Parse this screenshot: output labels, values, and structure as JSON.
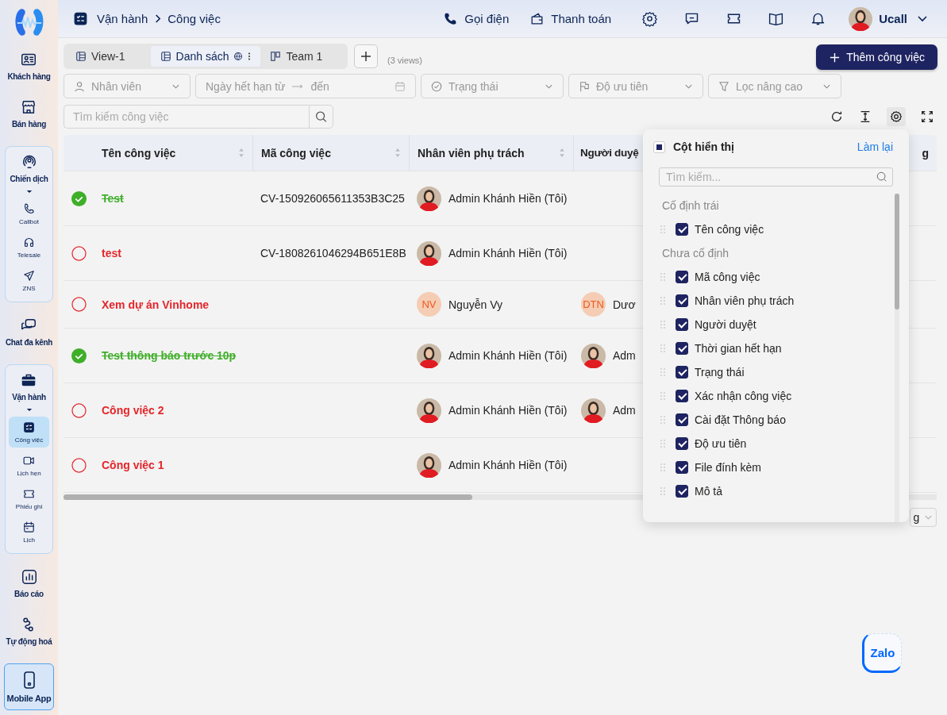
{
  "sidebar": {
    "items": [
      {
        "kind": "link",
        "label": "Khách hàng"
      },
      {
        "kind": "link",
        "label": "Bán hàng"
      },
      {
        "kind": "group",
        "label": "Chiến dịch",
        "expanded": true,
        "children": [
          {
            "label": "Callbot",
            "selected": false
          },
          {
            "label": "Telesale",
            "selected": false
          },
          {
            "label": "ZNS",
            "selected": false
          }
        ]
      },
      {
        "kind": "link",
        "label": "Chat đa kênh"
      },
      {
        "kind": "group",
        "label": "Vận hành",
        "expanded": true,
        "children": [
          {
            "label": "Công việc",
            "selected": true
          },
          {
            "label": "Lịch hẹn",
            "selected": false
          },
          {
            "label": "Phiếu ghi",
            "selected": false
          },
          {
            "label": "Lịch",
            "selected": false
          }
        ]
      },
      {
        "kind": "link",
        "label": "Báo cáo"
      },
      {
        "kind": "link",
        "label": "Tự động hoá"
      },
      {
        "kind": "app",
        "label": "Mobile App"
      }
    ]
  },
  "topbar": {
    "breadcrumb": [
      "Vận hành",
      "Công việc"
    ],
    "actions": [
      "Gọi điện",
      "Thanh toán"
    ],
    "user": "Ucall"
  },
  "views": {
    "tabs": [
      {
        "label": "View-1",
        "selected": false
      },
      {
        "label": "Danh sách",
        "selected": true
      },
      {
        "label": "Team 1",
        "selected": false
      }
    ],
    "count": "(3 views)"
  },
  "add_button": "Thêm công việc",
  "filters": {
    "staff": "Nhân viên",
    "date_from": "Ngày hết hạn từ",
    "date_to": "đến",
    "status": "Trạng thái",
    "priority": "Độ ưu tiên",
    "advanced": "Lọc nâng cao"
  },
  "search": {
    "placeholder": "Tìm kiếm công việc"
  },
  "table": {
    "columns": [
      "Tên công việc",
      "Mã công việc",
      "Nhân viên phụ trách",
      "Người duyệ",
      "g"
    ],
    "rows": [
      {
        "done": true,
        "name": "Test",
        "code": "CV-150926065611353B3C25",
        "assignee": {
          "kind": "photo",
          "name": "Admin Khánh Hiền (Tôi)"
        }
      },
      {
        "done": false,
        "name": "test",
        "code": "CV-1808261046294B651E8B",
        "assignee": {
          "kind": "photo",
          "name": "Admin Khánh Hiền (Tôi)"
        }
      },
      {
        "done": false,
        "name": "Xem dự án Vinhome",
        "assignee": {
          "kind": "initials",
          "initials": "NV",
          "name": "Nguyễn Vy"
        },
        "approver": {
          "kind": "initials",
          "initials": "DTN",
          "name": "Dươ"
        }
      },
      {
        "done": true,
        "name": "Test thông báo trước 10p",
        "assignee": {
          "kind": "photo",
          "name": "Admin Khánh Hiền (Tôi)"
        },
        "approver": {
          "kind": "photo",
          "name": "Adm"
        }
      },
      {
        "done": false,
        "name": "Công việc 2",
        "assignee": {
          "kind": "photo",
          "name": "Admin Khánh Hiền (Tôi)"
        },
        "approver": {
          "kind": "photo",
          "name": "Adm"
        }
      },
      {
        "done": false,
        "name": "Công việc 1",
        "assignee": {
          "kind": "photo",
          "name": "Admin Khánh Hiền (Tôi)"
        }
      }
    ]
  },
  "page_size": "g",
  "column_panel": {
    "title": "Cột hiển thị",
    "indeterminate": true,
    "reset": "Làm lại",
    "search_placeholder": "Tìm kiếm...",
    "groups": [
      {
        "label": "Cố định trái",
        "items": [
          {
            "label": "Tên công việc",
            "checked": true
          }
        ]
      },
      {
        "label": "Chưa cố định",
        "items": [
          {
            "label": "Mã công việc",
            "checked": true
          },
          {
            "label": "Nhân viên phụ trách",
            "checked": true
          },
          {
            "label": "Người duyệt",
            "checked": true
          },
          {
            "label": "Thời gian hết hạn",
            "checked": true
          },
          {
            "label": "Trạng thái",
            "checked": true
          },
          {
            "label": "Xác nhận công việc",
            "checked": true
          },
          {
            "label": "Cài đặt Thông báo",
            "checked": true
          },
          {
            "label": "Độ ưu tiên",
            "checked": true
          },
          {
            "label": "File đính kèm",
            "checked": true
          },
          {
            "label": "Mô tả",
            "checked": true
          }
        ]
      }
    ]
  },
  "zalo_button": "Zalo"
}
